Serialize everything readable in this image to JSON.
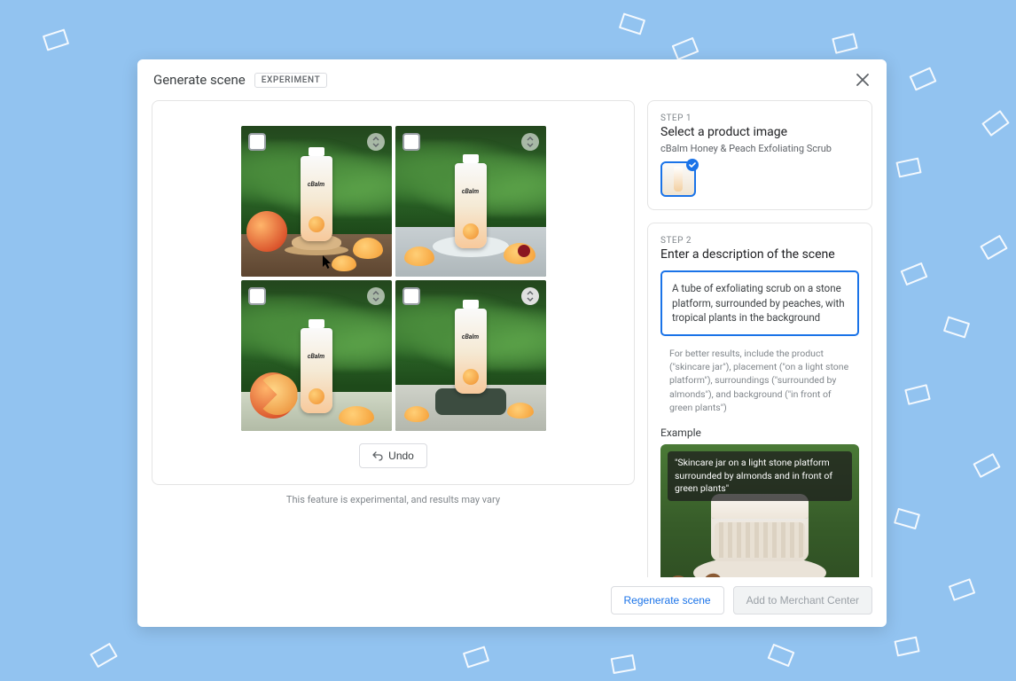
{
  "header": {
    "title": "Generate scene",
    "badge": "EXPERIMENT"
  },
  "canvas": {
    "tube_brand": "cBalm",
    "undo_label": "Undo",
    "disclaimer": "This feature is experimental, and results may vary"
  },
  "step1": {
    "label": "STEP 1",
    "title": "Select a product image",
    "product": "cBalm Honey & Peach Exfoliating Scrub"
  },
  "step2": {
    "label": "STEP 2",
    "title": "Enter a description of the scene",
    "description_value": "A tube of exfoliating scrub on a stone platform, surrounded by peaches, with tropical plants in the background",
    "hint": "For better results, include the product (\"skincare jar\"), placement (\"on a light stone platform\"), surroundings (\"surrounded by almonds\"), and background (\"in front of green plants\")",
    "example_label": "Example",
    "example_caption": "\"Skincare jar on a light stone platform surrounded by almonds and in front of green plants\""
  },
  "footer": {
    "regenerate": "Regenerate scene",
    "add": "Add to Merchant Center"
  }
}
